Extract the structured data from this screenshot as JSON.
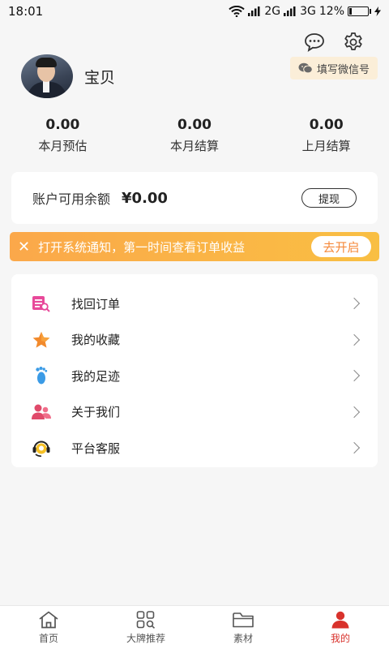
{
  "status_bar": {
    "time": "18:01",
    "signal": "2G",
    "network": "3G",
    "battery": "12%"
  },
  "profile": {
    "username": "宝贝",
    "wechat_button": "填写微信号"
  },
  "stats": [
    {
      "value": "0.00",
      "label": "本月预估"
    },
    {
      "value": "0.00",
      "label": "本月结算"
    },
    {
      "value": "0.00",
      "label": "上月结算"
    }
  ],
  "balance": {
    "label": "账户可用余额",
    "amount": "¥0.00",
    "withdraw_label": "提现"
  },
  "notice": {
    "text": "打开系统通知，第一时间查看订单收益",
    "button": "去开启"
  },
  "menu": [
    {
      "label": "找回订单",
      "icon": "order-search-icon"
    },
    {
      "label": "我的收藏",
      "icon": "star-icon"
    },
    {
      "label": "我的足迹",
      "icon": "footprint-icon"
    },
    {
      "label": "关于我们",
      "icon": "users-icon"
    },
    {
      "label": "平台客服",
      "icon": "headset-icon"
    }
  ],
  "tabs": [
    {
      "label": "首页",
      "icon": "home-icon"
    },
    {
      "label": "大牌推荐",
      "icon": "grid-search-icon"
    },
    {
      "label": "素材",
      "icon": "folder-icon"
    },
    {
      "label": "我的",
      "icon": "user-icon"
    }
  ],
  "colors": {
    "accent": "#d8322c",
    "notice_start": "#fba84a",
    "notice_end": "#f9bf43",
    "wechat_bg": "#fbeed8"
  }
}
